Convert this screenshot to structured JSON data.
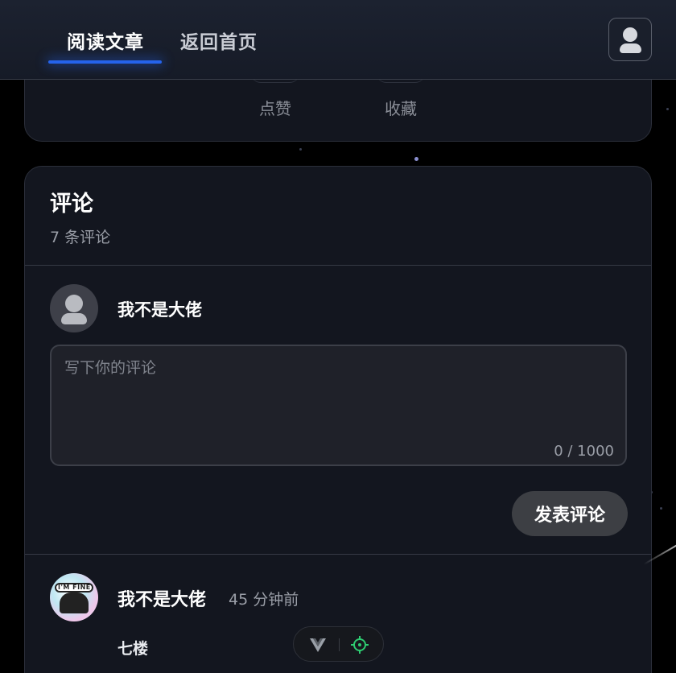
{
  "header": {
    "tabs": [
      {
        "label": "阅读文章",
        "active": true
      },
      {
        "label": "返回首页",
        "active": false
      }
    ],
    "user_icon": "user-icon",
    "accent_color": "#2563eb"
  },
  "article_actions": {
    "like_label": "点赞",
    "favorite_label": "收藏"
  },
  "comments": {
    "title": "评论",
    "count_text": "7 条评论",
    "composer": {
      "user_name": "我不是大佬",
      "placeholder": "写下你的评论",
      "value": "",
      "char_count": "0 / 1000",
      "submit_label": "发表评论"
    },
    "items": [
      {
        "author": "我不是大佬",
        "time": "45 分钟前",
        "avatar_badge": "I'M FINE",
        "text": "七楼"
      }
    ]
  },
  "dev_toolbar": {
    "icons": [
      "vue-icon",
      "crosshair-icon"
    ]
  }
}
